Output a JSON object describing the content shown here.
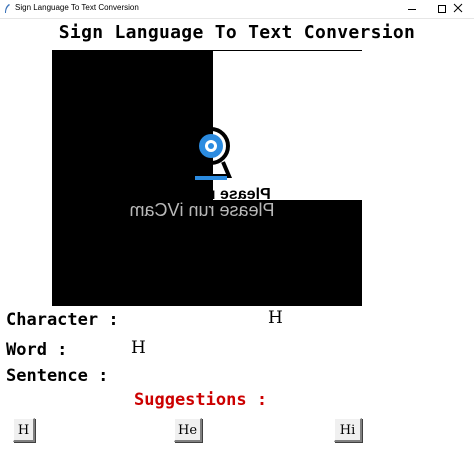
{
  "window": {
    "title": "Sign Language To Text Conversion"
  },
  "app": {
    "title": "Sign Language To Text Conversion"
  },
  "camera": {
    "overlay_text_mirrored": "Please run iVCam",
    "overlay_text_small": "Please r",
    "logo": "ivcam-webcam-icon",
    "accent_color": "#2b8be0"
  },
  "fields": {
    "character_label": "Character :",
    "character_value": "H",
    "word_label": "Word :",
    "word_value": "H",
    "sentence_label": "Sentence :",
    "sentence_value": ""
  },
  "suggestions": {
    "label": "Suggestions :",
    "color": "#cc0000",
    "buttons": [
      "H",
      "He",
      "Hi"
    ]
  }
}
